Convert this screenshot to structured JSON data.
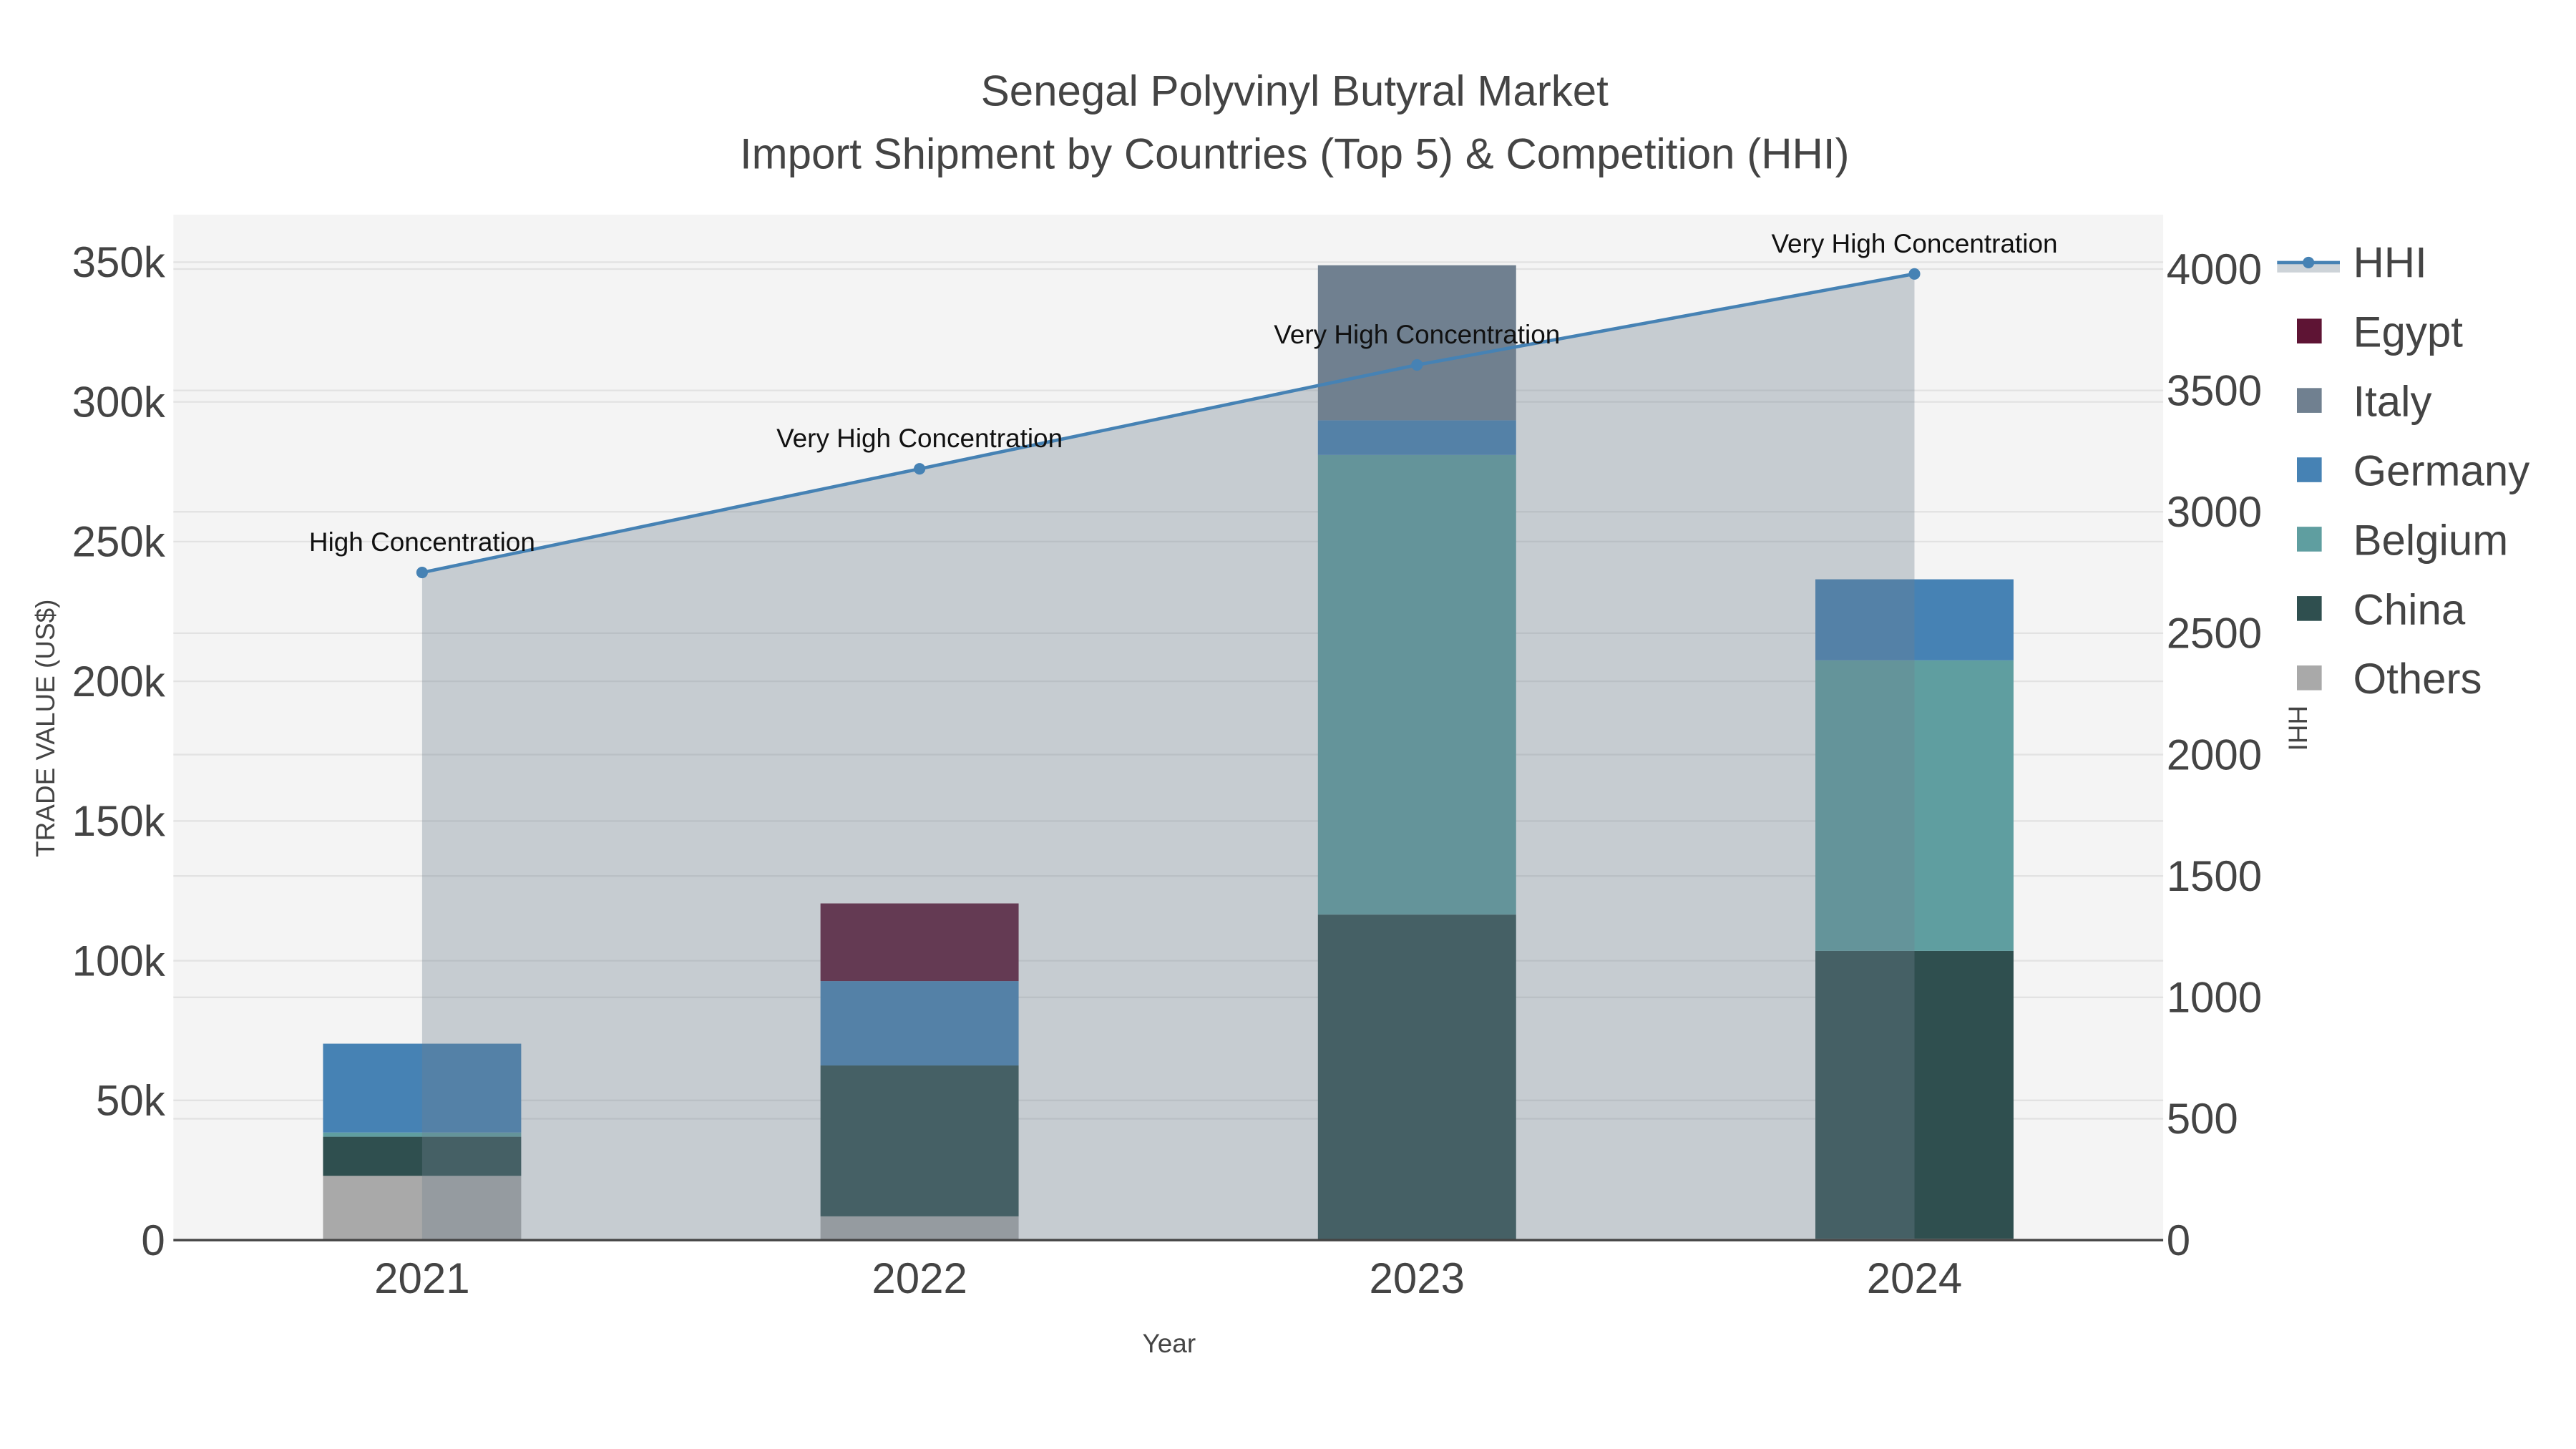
{
  "chart_data": {
    "type": "bar",
    "stacked": true,
    "title": "Senegal Polyvinyl Butyral Market",
    "subtitle": "Import Shipment by Countries (Top 5) & Competition (HHI)",
    "xlabel": "Year",
    "ylabel": "TRADE VALUE (US$)",
    "y2label": "HHI",
    "categories": [
      "2021",
      "2022",
      "2023",
      "2024"
    ],
    "ylim": [
      0,
      367000
    ],
    "y2lim": [
      0,
      4224
    ],
    "yticks": [
      0,
      50000,
      100000,
      150000,
      200000,
      250000,
      300000,
      350000
    ],
    "ytick_labels": [
      "0",
      "50k",
      "100k",
      "150k",
      "200k",
      "250k",
      "300k",
      "350k"
    ],
    "y2ticks": [
      0,
      500,
      1000,
      1500,
      2000,
      2500,
      3000,
      3500,
      4000
    ],
    "y2tick_labels": [
      "0",
      "500",
      "1000",
      "1500",
      "2000",
      "2500",
      "3000",
      "3500",
      "4000"
    ],
    "grid": true,
    "legend_position": "right",
    "series": [
      {
        "name": "Others",
        "color": "#a9a9a9",
        "values": [
          23000,
          8500,
          0,
          500
        ]
      },
      {
        "name": "China",
        "color": "#2f4f4f",
        "values": [
          14000,
          54000,
          116500,
          103000
        ]
      },
      {
        "name": "Belgium",
        "color": "#5f9ea0",
        "values": [
          1500,
          0,
          164500,
          104000
        ]
      },
      {
        "name": "Germany",
        "color": "#4682b4",
        "values": [
          31800,
          30200,
          12400,
          29000
        ]
      },
      {
        "name": "Italy",
        "color": "#708090",
        "values": [
          0,
          0,
          55500,
          0
        ]
      },
      {
        "name": "Egypt",
        "color": "#5e1434",
        "values": [
          0,
          27800,
          0,
          0
        ]
      }
    ],
    "hhi": {
      "name": "HHI",
      "color": "#4682b4",
      "values": [
        2750,
        3177,
        3605,
        3980
      ],
      "annotations": [
        "High Concentration",
        "Very High Concentration",
        "Very High Concentration",
        "Very High Concentration"
      ]
    },
    "legend": [
      "HHI",
      "Egypt",
      "Italy",
      "Germany",
      "Belgium",
      "China",
      "Others"
    ]
  }
}
